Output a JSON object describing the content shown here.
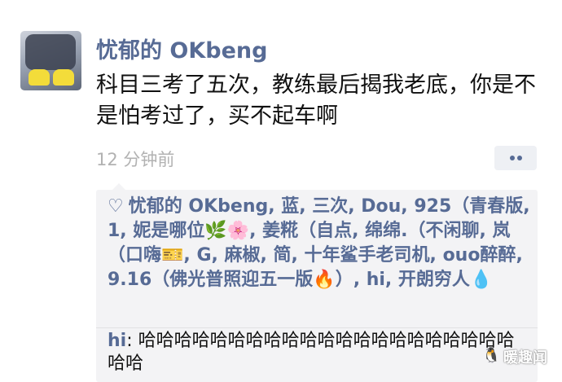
{
  "post": {
    "username": "忧郁的 OKbeng",
    "text": "科目三考了五次，教练最后揭我老底，你是不是怕考过了，买不起车啊",
    "timestamp": "12 分钟前",
    "more_icon": "more-dots-icon"
  },
  "likes": {
    "icon": "heart-outline-icon",
    "heart_glyph": "♡",
    "names_1": "忧郁的 OKbeng, 蓝, 三次, Dou, 925（青春版, 1, 妮是哪位",
    "emoji_1": "🌿🌸",
    "names_2": ", 姜糀（自点, 绵绵.（不闲聊, 岚（口嗨",
    "emoji_2": "🎫",
    "names_3": ", G, 麻椒, 简, 十年鲨手老司机, ouo醉醉, 9.16（佛光普照迎五一版",
    "emoji_3": "🔥",
    "names_4": "）, hi, 开朗穷人",
    "emoji_4": "💧"
  },
  "comment": {
    "commenter": "hi",
    "separator": ": ",
    "text": "哈哈哈哈哈哈哈哈哈哈哈哈哈哈哈哈哈哈哈哈哈哈哈"
  },
  "watermark": {
    "logo": "🐧",
    "text": "暖趣闻"
  },
  "colors": {
    "link": "#576b95",
    "timestamp": "#b2b2b2",
    "panel": "#f3f3f5"
  }
}
